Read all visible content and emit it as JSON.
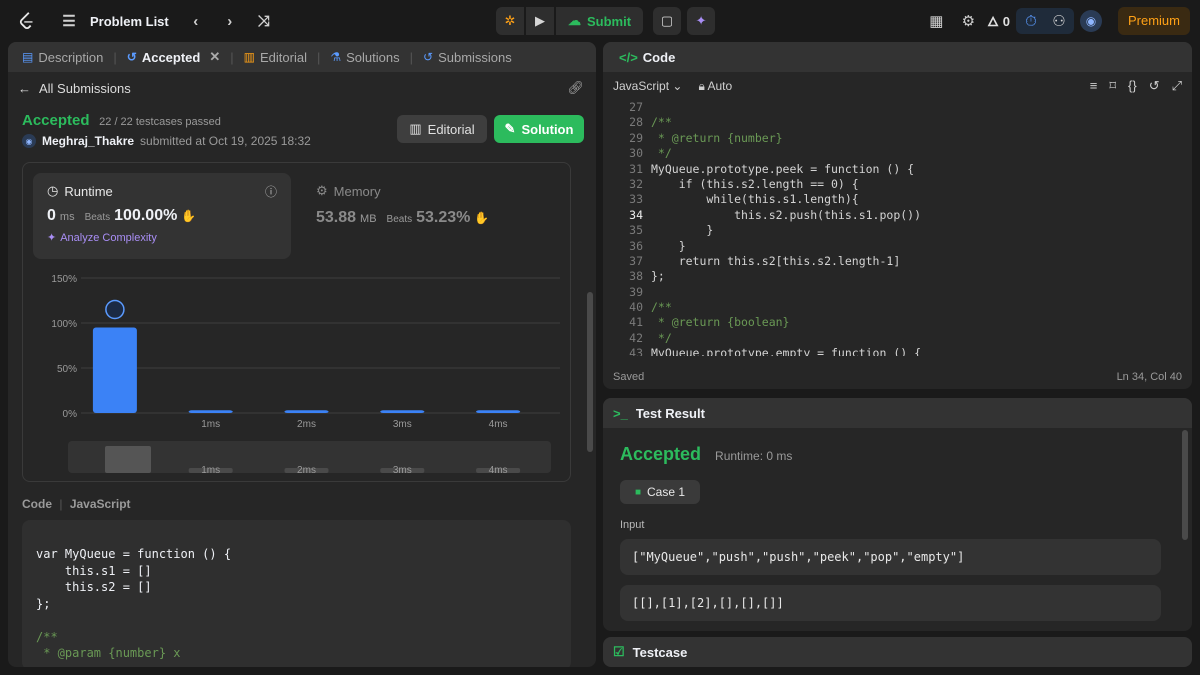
{
  "topbar": {
    "title": "Problem List",
    "submit_label": "Submit",
    "streak_count": "0",
    "premium_label": "Premium"
  },
  "left_tabs": [
    {
      "label": "Description"
    },
    {
      "label": "Accepted"
    },
    {
      "label": "Editorial"
    },
    {
      "label": "Solutions"
    },
    {
      "label": "Submissions"
    }
  ],
  "back_label": "All Submissions",
  "submission": {
    "status": "Accepted",
    "passed": "22 / 22 testcases passed",
    "user": "Meghraj_Thakre",
    "submitted_text": "submitted at Oct 19, 2025 18:32",
    "editorial_btn": "Editorial",
    "solution_btn": "Solution"
  },
  "runtime": {
    "label": "Runtime",
    "value": "0",
    "unit": "ms",
    "beats_label": "Beats",
    "beats_pct": "100.00%",
    "analyze_label": "Analyze Complexity"
  },
  "memory": {
    "label": "Memory",
    "value": "53.88",
    "unit": "MB",
    "beats_label": "Beats",
    "beats_pct": "53.23%"
  },
  "chart_data": {
    "type": "bar",
    "categories": [
      "",
      "1ms",
      "2ms",
      "3ms",
      "4ms"
    ],
    "values": [
      95,
      3,
      3,
      3,
      3
    ],
    "yticks": [
      "0%",
      "50%",
      "100%",
      "150%"
    ],
    "ylim": [
      0,
      150
    ],
    "xlabel": "",
    "ylabel": ""
  },
  "code_section": {
    "label": "Code",
    "language": "JavaScript",
    "lines": [
      "var MyQueue = function () {",
      "    this.s1 = []",
      "    this.s2 = []",
      "};",
      "",
      "/**",
      " * @param {number} x"
    ]
  },
  "editor": {
    "tab_label": "Code",
    "language": "JavaScript",
    "mode": "Auto",
    "status": "Saved",
    "cursor": "Ln 34, Col 40",
    "line_numbers": [
      "27",
      "28",
      "29",
      "30",
      "31",
      "32",
      "33",
      "34",
      "35",
      "36",
      "37",
      "38",
      "39",
      "40",
      "41",
      "42",
      "43"
    ],
    "lines": [
      "",
      "/**",
      " * @return {number}",
      " */",
      "MyQueue.prototype.peek = function () {",
      "    if (this.s2.length == 0) {",
      "        while(this.s1.length){",
      "            this.s2.push(this.s1.pop())",
      "        }",
      "    }",
      "    return this.s2[this.s2.length-1]",
      "};",
      "",
      "/**",
      " * @return {boolean}",
      " */",
      "MyQueue.prototype.empty = function () {"
    ]
  },
  "test_result": {
    "header": "Test Result",
    "status": "Accepted",
    "runtime": "Runtime: 0 ms",
    "case_label": "Case 1",
    "input_label": "Input",
    "input_lines": [
      "[\"MyQueue\",\"push\",\"push\",\"peek\",\"pop\",\"empty\"]",
      "[[],[1],[2],[],[],[]]"
    ]
  },
  "testcase_label": "Testcase"
}
